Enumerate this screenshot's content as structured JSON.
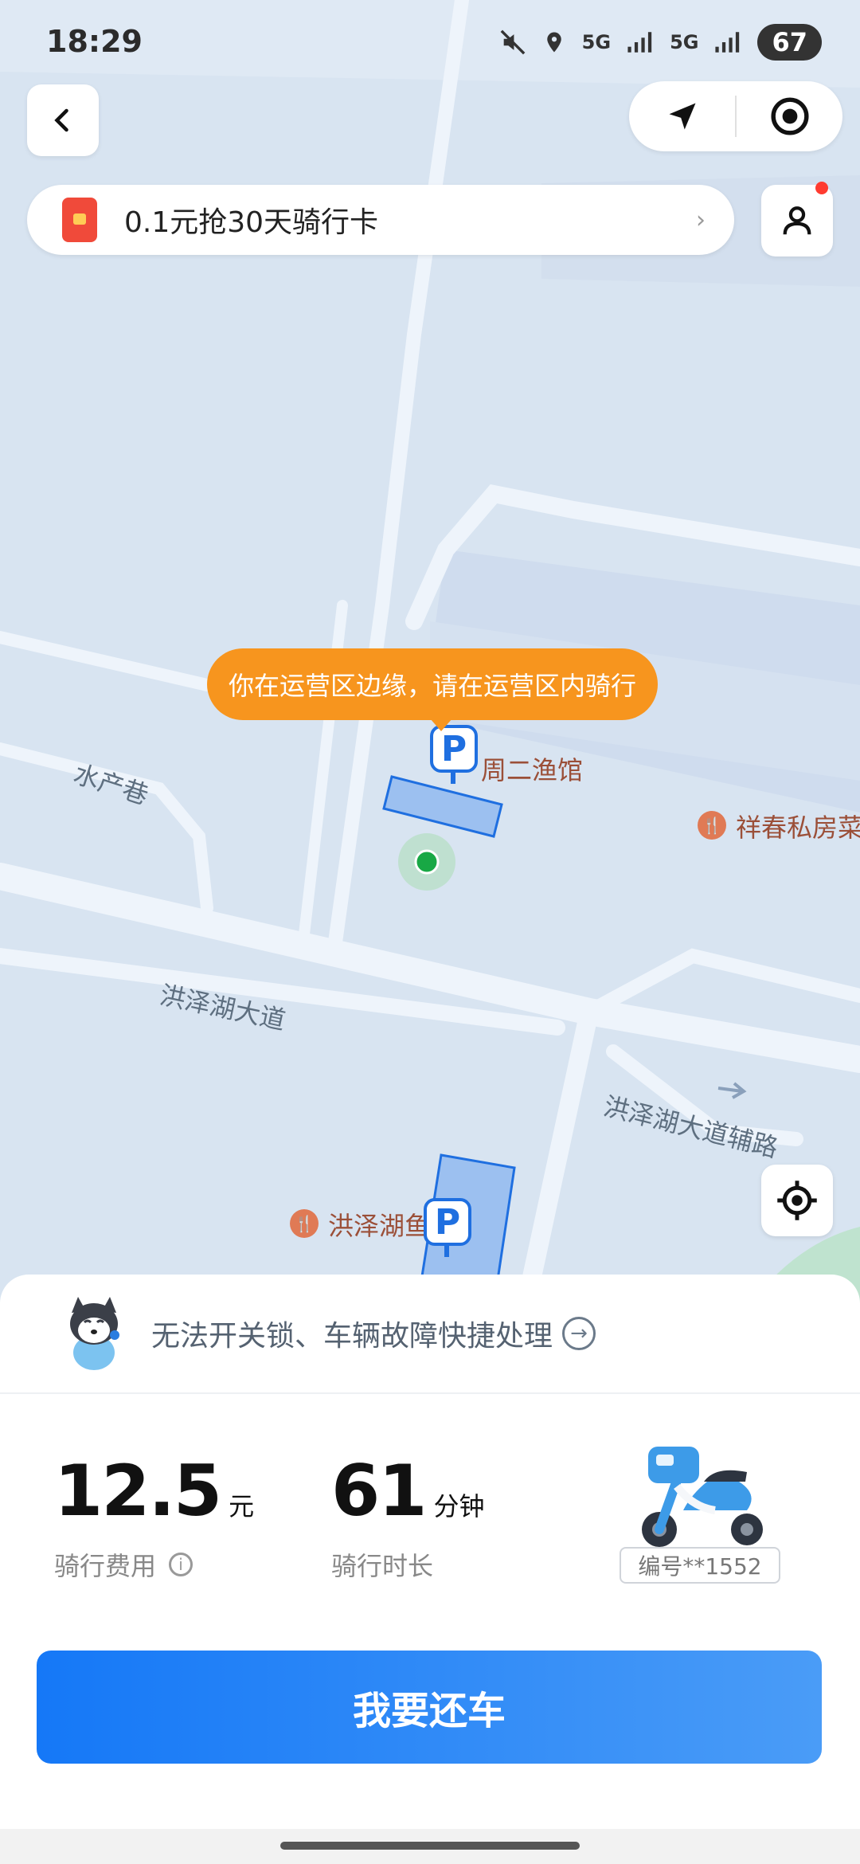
{
  "status_bar": {
    "time": "18:29",
    "network1": "5G",
    "network2": "5G",
    "battery": "67"
  },
  "promo": {
    "text": "0.1元抢30天骑行卡",
    "chevron": "›"
  },
  "map": {
    "tooltip": "你在运营区边缘，请在运营区内骑行",
    "street_labels": {
      "shuichan": "水产巷",
      "hongzehu": "洪泽湖大道",
      "hongzehu_side": "洪泽湖大道辅路"
    },
    "pois": {
      "zhouer": "周二渔馆",
      "xiangchun": "祥春私房菜",
      "hongzehu_fish": "洪泽湖鱼馆"
    },
    "parking_symbol": "P"
  },
  "help": {
    "text": "无法开关锁、车辆故障快捷处理"
  },
  "ride": {
    "fee": "12.5",
    "fee_unit": "元",
    "fee_label": "骑行费用",
    "duration": "61",
    "duration_unit": "分钟",
    "duration_label": "骑行时长",
    "bike_id": "编号**1552"
  },
  "actions": {
    "return_button": "我要还车"
  },
  "colors": {
    "accent": "#1578f7",
    "tooltip": "#f7951e",
    "parking_blue": "#1f6fe0",
    "user_dot": "#ff3b30"
  }
}
